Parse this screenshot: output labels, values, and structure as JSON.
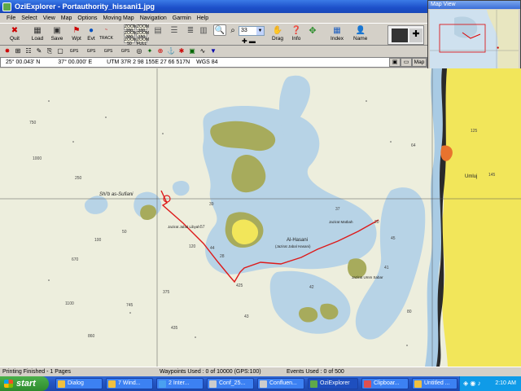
{
  "window": {
    "title": "OziExplorer - Portauthority_hissani1.jpg"
  },
  "menu": [
    "File",
    "Select",
    "View",
    "Map",
    "Options",
    "Moving Map",
    "Navigation",
    "Garmin",
    "Help"
  ],
  "toolbar": {
    "quit": "Quit",
    "load": "Load",
    "save": "Save",
    "wpt": "Wpt",
    "evt": "Evt",
    "trk": "TRACK",
    "drag": "Drag",
    "info": "Info",
    "index": "Index",
    "name": "Name",
    "zoom_value": "33",
    "zoom_btns": [
      "ZOOM 200",
      "ZOOM 100",
      "ZOOM 300",
      "ZOOM 150",
      "ZOOM 50",
      "ZOOM FULL",
      "ZOOM 25"
    ]
  },
  "coords": {
    "lat": "25° 00.043' N",
    "lon": "37° 00.000' E",
    "utm": "UTM  37R   2 98 155E    27 66 517N",
    "datum": "WGS 84",
    "map_button": "Map"
  },
  "mapview": {
    "title": "Map View"
  },
  "map_labels": {
    "shib": "Shi'b as-Sufiani",
    "libyah": "Jazirat Jabal Libyah",
    "alhasani": "Al-Hasani",
    "jabal_hasani": "(Jazirat Jabal Hasani)",
    "matbah": "Jazirat Matbah",
    "ummsabar": "Jazirat Umm Sabar",
    "umluj": "Umluj",
    "depths": [
      "750",
      "1000",
      "250",
      "50",
      "100",
      "670",
      "1100",
      "860",
      "745",
      "375",
      "425",
      "435",
      "120",
      "57",
      "39",
      "44",
      "28",
      "42",
      "43",
      "20",
      "45",
      "37",
      "41",
      "64",
      "125",
      "145",
      "80"
    ]
  },
  "status": {
    "printing": "Printing Finished - 1 Pages",
    "waypoints": "Waypoints Used : 0 of 10000  (GPS:100)",
    "events": "Events Used : 0 of 500"
  },
  "taskbar": {
    "start": "start",
    "tasks": [
      "Dialog",
      "7 Wind...",
      "2 Inter...",
      "Conf_25...",
      "Confluen...",
      "OziExplorer",
      "Clipboar...",
      "Untitled ..."
    ],
    "time": "2:10 AM"
  }
}
